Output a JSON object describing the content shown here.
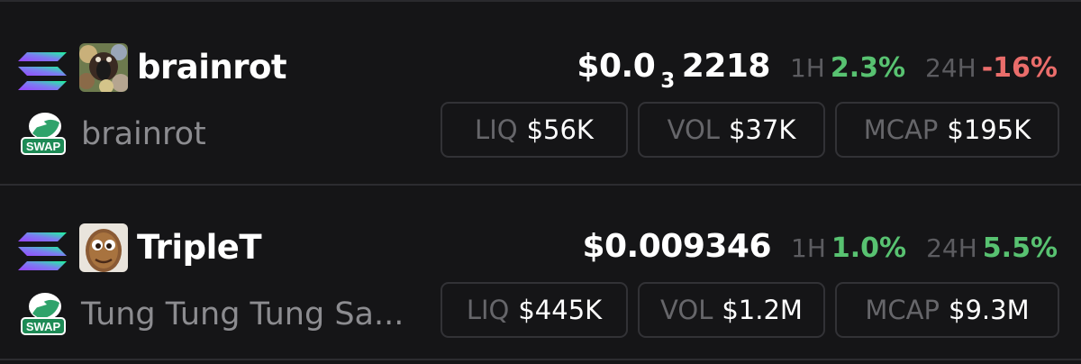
{
  "tokens": [
    {
      "symbol": "brainrot",
      "name": "brainrot",
      "price_main": "$0.0",
      "price_sub": "3",
      "price_tail": "2218",
      "h1_label": "1H",
      "h1_change": "2.3%",
      "h24_label": "24H",
      "h24_change": "-16%",
      "liq_label": "LIQ",
      "liq_value": "$56K",
      "vol_label": "VOL",
      "vol_value": "$37K",
      "mcap_label": "MCAP",
      "mcap_value": "$195K",
      "dex_badge": "SWAP"
    },
    {
      "symbol": "TripleT",
      "name": "Tung Tung Tung Sa...",
      "price": "$0.009346",
      "h1_label": "1H",
      "h1_change": "1.0%",
      "h24_label": "24H",
      "h24_change": "5.5%",
      "liq_label": "LIQ",
      "liq_value": "$445K",
      "vol_label": "VOL",
      "vol_value": "$1.2M",
      "mcap_label": "MCAP",
      "mcap_value": "$9.3M",
      "dex_badge": "SWAP"
    }
  ],
  "colors": {
    "background": "#151517",
    "positive": "#58c271",
    "negative": "#ea6d6b",
    "muted": "#8c8c90",
    "border": "#323236"
  },
  "icons": {
    "chain": "solana-icon",
    "dex": "raydium-swap-icon"
  }
}
